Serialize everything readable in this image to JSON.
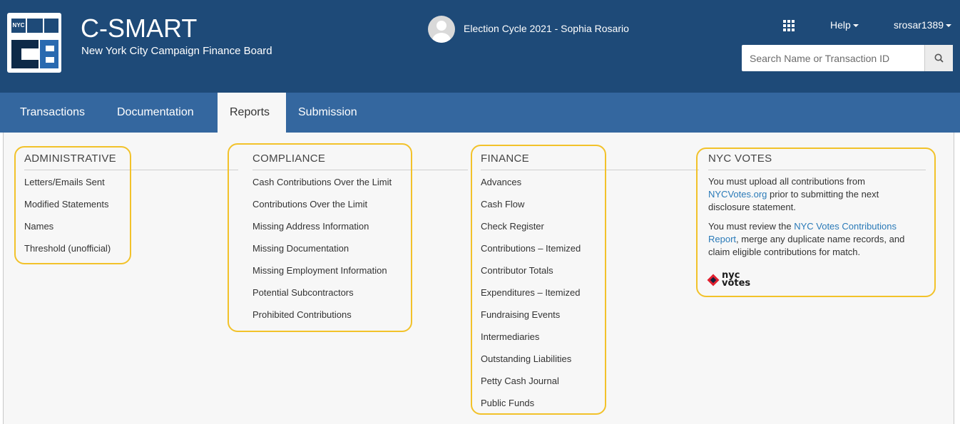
{
  "header": {
    "logo_label": "NYC",
    "app_title": "C-SMART",
    "app_subtitle": "New York City Campaign Finance Board",
    "cycle_text": "Election Cycle 2021 - Sophia Rosario",
    "help_label": "Help",
    "user_label": "srosar1389",
    "search_placeholder": "Search Name or Transaction ID",
    "icons": [
      "apps-grid-icon",
      "search-icon",
      "avatar-icon",
      "caret-down-icon"
    ]
  },
  "nav": {
    "tabs": [
      "Transactions",
      "Documentation",
      "Reports",
      "Submission"
    ],
    "active_tab": "Reports"
  },
  "sections": {
    "administrative": {
      "title": "ADMINISTRATIVE",
      "items": [
        "Letters/Emails Sent",
        "Modified Statements",
        "Names",
        "Threshold (unofficial)"
      ]
    },
    "compliance": {
      "title": "COMPLIANCE",
      "items": [
        "Cash Contributions Over the Limit",
        "Contributions Over the Limit",
        "Missing Address Information",
        "Missing Documentation",
        "Missing Employment Information",
        "Potential Subcontractors",
        "Prohibited Contributions"
      ]
    },
    "finance": {
      "title": "FINANCE",
      "items": [
        "Advances",
        "Cash Flow",
        "Check Register",
        "Contributions – Itemized",
        "Contributor Totals",
        "Expenditures – Itemized",
        "Fundraising Events",
        "Intermediaries",
        "Outstanding Liabilities",
        "Petty Cash Journal",
        "Public Funds"
      ]
    },
    "nyc_votes": {
      "title": "NYC VOTES",
      "p1_before": "You must upload all contributions from ",
      "p1_link": "NYCVotes.org",
      "p1_after": " prior to submitting the next disclosure statement.",
      "p2_before": "You must review the ",
      "p2_link": "NYC Votes Contributions Report",
      "p2_after": ", merge any duplicate name records, and claim eligible contributions for match.",
      "logo_line1": "nyc",
      "logo_line2": "votes"
    }
  },
  "colors": {
    "header_bg": "#1e4a78",
    "nav_bg": "#34679f",
    "content_bg": "#f7f7f7",
    "highlight": "#f2c22a",
    "link": "#2a7ab8"
  }
}
